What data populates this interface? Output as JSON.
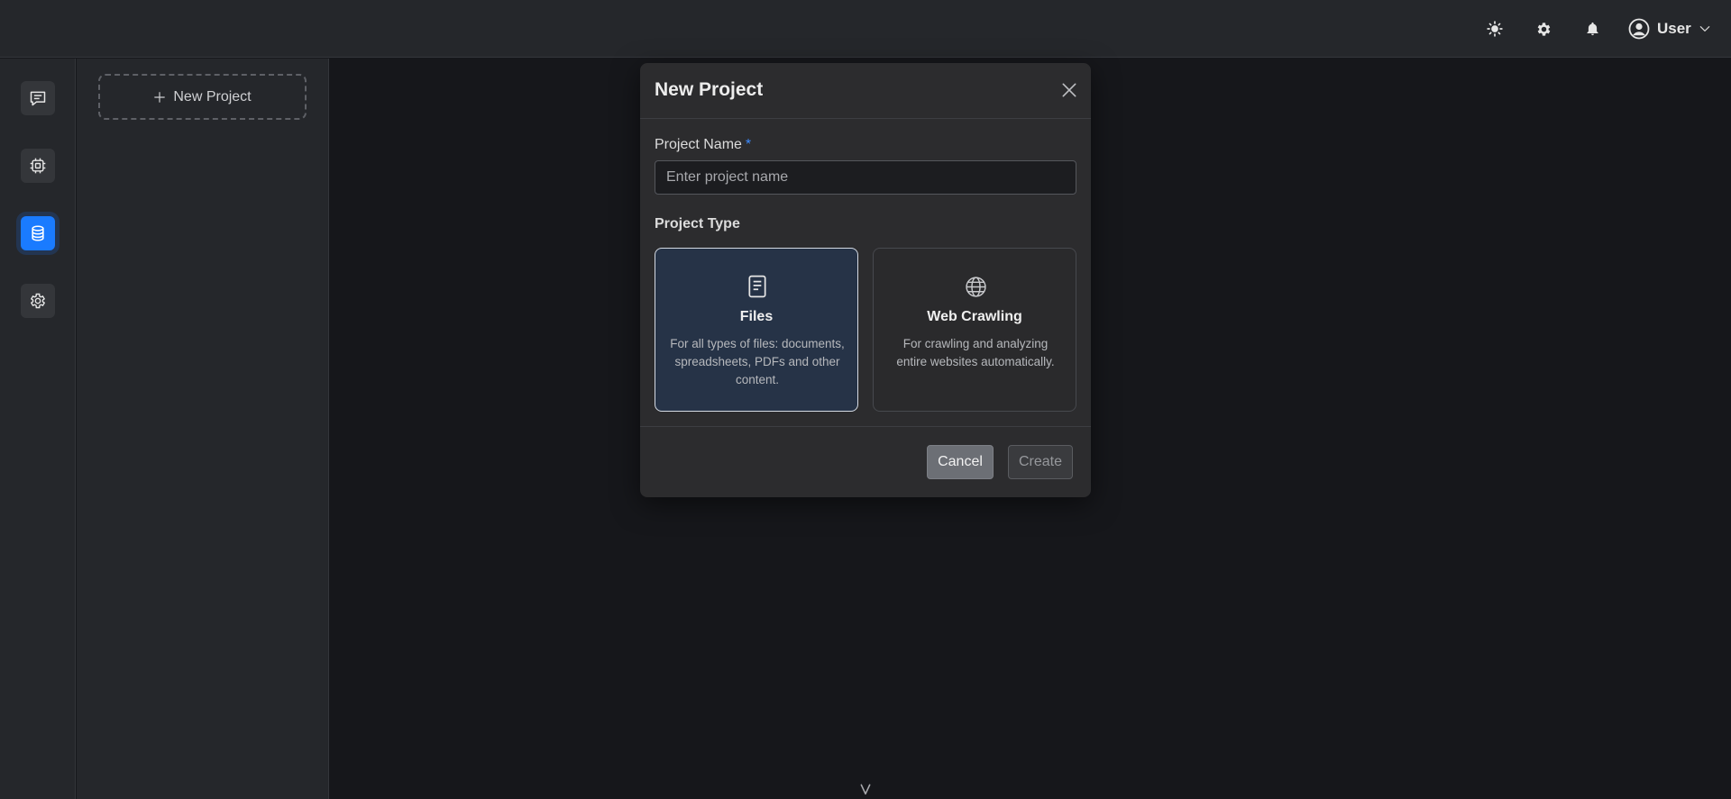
{
  "header": {
    "icons": [
      "sun-icon",
      "gear-icon",
      "bell-icon"
    ],
    "user": {
      "name": "User",
      "avatar_icon": "user-circle-icon",
      "dropdown_icon": "chevron-down-icon"
    }
  },
  "rail": {
    "items": [
      {
        "name": "chat",
        "icon": "chat-icon",
        "active": false
      },
      {
        "name": "models",
        "icon": "chip-icon",
        "active": false
      },
      {
        "name": "knowledge-base",
        "icon": "database-icon",
        "active": true
      },
      {
        "name": "settings",
        "icon": "gear-icon",
        "active": false
      }
    ]
  },
  "panel": {
    "new_project_label": "New Project"
  },
  "modal": {
    "title": "New Project",
    "name_label": "Project Name",
    "required_mark": "*",
    "name_value": "",
    "name_placeholder": "Enter project name",
    "type_label": "Project Type",
    "types": [
      {
        "title": "Files",
        "description": "For all types of files: documents, spreadsheets, PDFs and other content.",
        "icon": "document-icon",
        "selected": true
      },
      {
        "title": "Web Crawling",
        "description": "For crawling and analyzing entire websites automatically.",
        "icon": "globe-icon",
        "selected": false
      }
    ],
    "cancel_label": "Cancel",
    "create_label": "Create"
  },
  "colors": {
    "accent": "#1a7bff",
    "background": "#16171b",
    "surface": "#25272b",
    "modal": "#2c2c2e",
    "selected_card": "#263347"
  }
}
